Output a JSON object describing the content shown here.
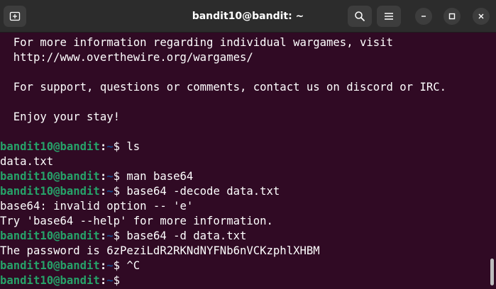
{
  "window": {
    "title": "bandit10@bandit: ~"
  },
  "titlebar": {
    "buttons": [
      "new-tab",
      "search",
      "menu",
      "minimize",
      "maximize",
      "close"
    ]
  },
  "terminal": {
    "motd": [
      "  For more information regarding individual wargames, visit",
      "  http://www.overthewire.org/wargames/",
      "",
      "  For support, questions or comments, contact us on discord or IRC.",
      "",
      "  Enjoy your stay!",
      ""
    ],
    "prompt": {
      "user": "bandit10@bandit",
      "colon": ":",
      "path": "~",
      "symbol": "$ "
    },
    "entries": [
      {
        "type": "prompt",
        "command": "ls"
      },
      {
        "type": "output",
        "text": "data.txt"
      },
      {
        "type": "prompt",
        "command": "man base64"
      },
      {
        "type": "prompt",
        "command": "base64 -decode data.txt"
      },
      {
        "type": "output",
        "text": "base64: invalid option -- 'e'"
      },
      {
        "type": "output",
        "text": "Try 'base64 --help' for more information."
      },
      {
        "type": "prompt",
        "command": "base64 -d data.txt"
      },
      {
        "type": "output",
        "text": "The password is 6zPeziLdR2RKNdNYFNb6nVCKzphlXHBM"
      },
      {
        "type": "prompt",
        "command": "^C"
      },
      {
        "type": "prompt",
        "command": ""
      }
    ]
  },
  "colors": {
    "background": "#300a24",
    "user": "#26a269",
    "path": "#12488b",
    "titlebar": "#2c2c2c"
  }
}
